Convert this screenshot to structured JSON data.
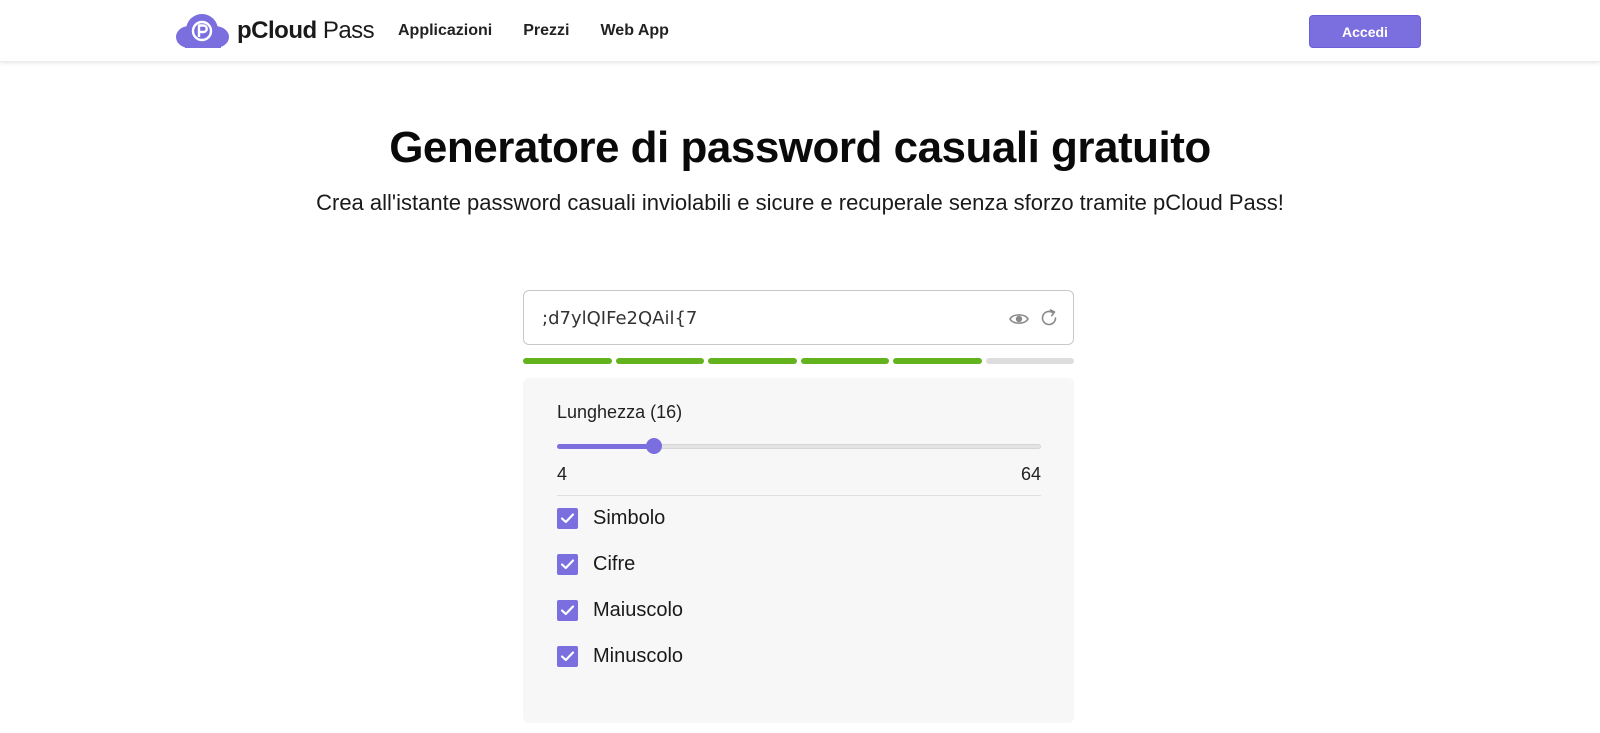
{
  "header": {
    "logo_bold": "pCloud",
    "logo_light": "Pass",
    "nav": [
      {
        "label": "Applicazioni"
      },
      {
        "label": "Prezzi"
      },
      {
        "label": "Web App"
      }
    ],
    "login_label": "Accedi"
  },
  "hero": {
    "title": "Generatore di password casuali gratuito",
    "subtitle": "Crea all'istante password casuali inviolabili e sicure e recuperale senza sforzo tramite pCloud Pass!"
  },
  "generator": {
    "password": ";d7ylQIFe2QAil{7",
    "strength_level": 5,
    "strength_max": 6,
    "length_label": "Lunghezza (16)",
    "length_value": 16,
    "length_min": "4",
    "length_max": "64",
    "options": [
      {
        "label": "Simbolo",
        "checked": true
      },
      {
        "label": "Cifre",
        "checked": true
      },
      {
        "label": "Maiuscolo",
        "checked": true
      },
      {
        "label": "Minuscolo",
        "checked": true
      }
    ]
  },
  "colors": {
    "accent": "#7b6fe0",
    "strength_on": "#62b31d",
    "strength_off": "#dddddd"
  },
  "icons": {
    "logo": "pcloud-pass-logo-icon",
    "show_password": "eye-icon",
    "regenerate": "refresh-icon",
    "checkbox": "checkmark-icon"
  }
}
